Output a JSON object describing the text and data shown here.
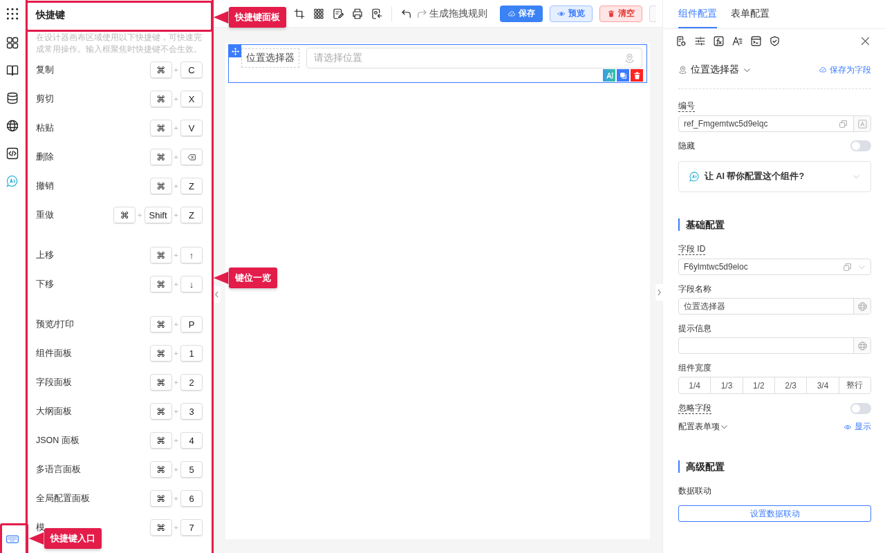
{
  "shortcut_panel": {
    "title": "快捷键",
    "description": "在设计器画布区域使用以下快捷键，可快速完成常用操作。输入框聚焦时快捷键不会生效。",
    "groups": [
      [
        {
          "label": "复制",
          "keys": [
            {
              "kind": "key",
              "text": "⌘"
            },
            {
              "kind": "sep",
              "text": "+"
            },
            {
              "kind": "key",
              "text": "C"
            }
          ]
        },
        {
          "label": "剪切",
          "keys": [
            {
              "kind": "key",
              "text": "⌘"
            },
            {
              "kind": "sep",
              "text": "+"
            },
            {
              "kind": "key",
              "text": "X"
            }
          ]
        },
        {
          "label": "粘贴",
          "keys": [
            {
              "kind": "key",
              "text": "⌘"
            },
            {
              "kind": "sep",
              "text": "+"
            },
            {
              "kind": "key",
              "text": "V"
            }
          ]
        },
        {
          "label": "删除",
          "keys": [
            {
              "kind": "key",
              "text": "⌘"
            },
            {
              "kind": "sep",
              "text": "+"
            },
            {
              "kind": "backspace"
            }
          ]
        },
        {
          "label": "撤销",
          "keys": [
            {
              "kind": "key",
              "text": "⌘"
            },
            {
              "kind": "sep",
              "text": "+"
            },
            {
              "kind": "key",
              "text": "Z"
            }
          ]
        },
        {
          "label": "重做",
          "keys": [
            {
              "kind": "key",
              "text": "⌘"
            },
            {
              "kind": "sep",
              "text": "+"
            },
            {
              "kind": "key",
              "text": "Shift"
            },
            {
              "kind": "sep",
              "text": "+"
            },
            {
              "kind": "key",
              "text": "Z"
            }
          ]
        }
      ],
      [
        {
          "label": "上移",
          "keys": [
            {
              "kind": "key",
              "text": "⌘"
            },
            {
              "kind": "sep",
              "text": "+"
            },
            {
              "kind": "key",
              "text": "↑"
            }
          ]
        },
        {
          "label": "下移",
          "keys": [
            {
              "kind": "key",
              "text": "⌘"
            },
            {
              "kind": "sep",
              "text": "+"
            },
            {
              "kind": "key",
              "text": "↓"
            }
          ]
        }
      ],
      [
        {
          "label": "预览/打印",
          "keys": [
            {
              "kind": "key",
              "text": "⌘"
            },
            {
              "kind": "sep",
              "text": "+"
            },
            {
              "kind": "key",
              "text": "P"
            }
          ]
        },
        {
          "label": "组件面板",
          "keys": [
            {
              "kind": "key",
              "text": "⌘"
            },
            {
              "kind": "sep",
              "text": "+"
            },
            {
              "kind": "key",
              "text": "1"
            }
          ]
        },
        {
          "label": "字段面板",
          "keys": [
            {
              "kind": "key",
              "text": "⌘"
            },
            {
              "kind": "sep",
              "text": "+"
            },
            {
              "kind": "key",
              "text": "2"
            }
          ]
        },
        {
          "label": "大纲面板",
          "keys": [
            {
              "kind": "key",
              "text": "⌘"
            },
            {
              "kind": "sep",
              "text": "+"
            },
            {
              "kind": "key",
              "text": "3"
            }
          ]
        },
        {
          "label": "JSON 面板",
          "keys": [
            {
              "kind": "key",
              "text": "⌘"
            },
            {
              "kind": "sep",
              "text": "+"
            },
            {
              "kind": "key",
              "text": "4"
            }
          ]
        },
        {
          "label": "多语言面板",
          "keys": [
            {
              "kind": "key",
              "text": "⌘"
            },
            {
              "kind": "sep",
              "text": "+"
            },
            {
              "kind": "key",
              "text": "5"
            }
          ]
        },
        {
          "label": "全局配置面板",
          "keys": [
            {
              "kind": "key",
              "text": "⌘"
            },
            {
              "kind": "sep",
              "text": "+"
            },
            {
              "kind": "key",
              "text": "6"
            }
          ]
        },
        {
          "label": "模",
          "keys": [
            {
              "kind": "key",
              "text": "⌘"
            },
            {
              "kind": "sep",
              "text": "+"
            },
            {
              "kind": "key",
              "text": "7"
            }
          ]
        }
      ]
    ]
  },
  "toolbar": {
    "rule_label": "生成拖拽规则",
    "buttons": [
      {
        "label": "保存",
        "kind": "primary"
      },
      {
        "label": "预览",
        "kind": "info"
      },
      {
        "label": "清空",
        "kind": "danger"
      }
    ]
  },
  "canvas": {
    "field": {
      "label": "位置选择器",
      "placeholder": "请选择位置",
      "selected": true
    }
  },
  "right_panel": {
    "tabs": [
      {
        "label": "组件配置",
        "selected": true
      },
      {
        "label": "表单配置",
        "selected": false
      }
    ],
    "component": {
      "name": "位置选择器",
      "save_link": "保存为字段"
    },
    "items": [
      {
        "kind": "input",
        "label": "编号",
        "dashed": true,
        "value": "ref_Fmgemtwc5d9elqc",
        "addon": {
          "kind": "letter"
        }
      },
      {
        "kind": "toggle",
        "label": "隐藏",
        "on": false
      },
      {
        "kind": "ai",
        "text": "让 AI 帮你配置这个组件?",
        "expanded": false
      },
      {
        "kind": "section",
        "text": "基础配置"
      },
      {
        "kind": "select",
        "label": "字段 ID",
        "dashed": true,
        "value": "F6ylmtwc5d9eloc"
      },
      {
        "kind": "input",
        "label": "字段名称",
        "dashed": false,
        "value": "位置选择器",
        "addon": {
          "kind": "globe"
        }
      },
      {
        "kind": "input",
        "label": "提示信息",
        "dashed": false,
        "addon": {
          "kind": "globe"
        }
      },
      {
        "kind": "segmented",
        "label": "组件宽度",
        "options": [
          {
            "text": "1/4",
            "selected": false
          },
          {
            "text": "1/3",
            "selected": false
          },
          {
            "text": "1/2",
            "selected": false
          },
          {
            "text": "2/3",
            "selected": false
          },
          {
            "text": "3/4",
            "selected": false
          },
          {
            "text": "整行",
            "selected": false
          }
        ]
      },
      {
        "kind": "toggle",
        "label": "忽略字段",
        "dashed": true,
        "on": false
      },
      {
        "kind": "expander",
        "label": "配置表单项",
        "link": "显示"
      },
      {
        "kind": "section",
        "text": "高级配置"
      },
      {
        "kind": "button",
        "label": "数据联动",
        "button": "设置数据联动"
      }
    ]
  },
  "annotations": [
    {
      "kind": "right",
      "text": "快捷键面板"
    },
    {
      "kind": "right",
      "text": "键位一览"
    },
    {
      "kind": "right",
      "text": "快捷键入口"
    }
  ]
}
